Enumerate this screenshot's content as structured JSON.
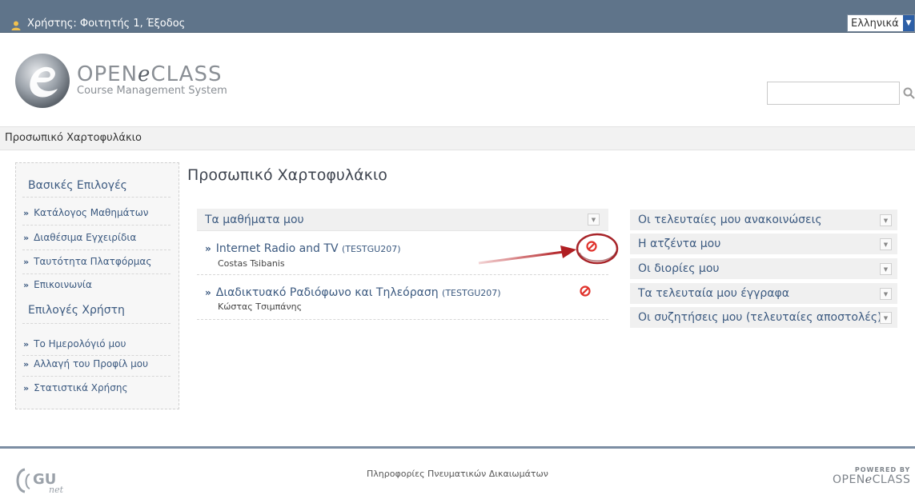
{
  "topbar": {
    "user_text": "Χρήστης: Φοιτητής 1, Έξοδος",
    "language": "Ελληνικά"
  },
  "logo": {
    "brand_open": "OPEN",
    "brand_e": "e",
    "brand_class": "CLASS",
    "subtitle": "Course Management System"
  },
  "search": {
    "placeholder": ""
  },
  "breadcrumb": {
    "current": "Προσωπικό Χαρτοφυλάκιο"
  },
  "sidebar": {
    "basic_heading": "Βασικές Επιλογές",
    "basic_items": [
      {
        "label": "Κατάλογος Μαθημάτων"
      },
      {
        "label": "Διαθέσιμα Εγχειρίδια"
      },
      {
        "label": "Ταυτότητα Πλατφόρμας"
      },
      {
        "label": "Επικοινωνία"
      }
    ],
    "user_heading": "Επιλογές Χρήστη",
    "user_items": [
      {
        "label": "Το Ημερολόγιό μου"
      },
      {
        "label": "Αλλαγή του Προφίλ μου"
      },
      {
        "label": "Στατιστικά Χρήσης"
      }
    ],
    "bullet": "»"
  },
  "main": {
    "title": "Προσωπικό Χαρτοφυλάκιο",
    "courses_header": "Τα μαθήματα μου",
    "courses": [
      {
        "name": "Internet Radio and TV",
        "code": "(TESTGU207)",
        "instructor": "Costas Tsibanis"
      },
      {
        "name": "Διαδικτυακό Ραδιόφωνο και Τηλεόραση",
        "code": "(TESTGU207)",
        "instructor": "Κώστας Τσιμπάνης"
      }
    ],
    "bullet": "»"
  },
  "right_panel": {
    "items": [
      {
        "label": "Οι τελευταίες μου ανακοινώσεις"
      },
      {
        "label": "Η ατζέντα μου"
      },
      {
        "label": "Οι διορίες μου"
      },
      {
        "label": "Τα τελευταία μου έγγραφα"
      },
      {
        "label": "Οι συζητήσεις μου (τελευταίες αποστολές)"
      }
    ]
  },
  "footer": {
    "copyright": "Πληροφορίες Πνευματικών Δικαιωμάτων",
    "powered_by": "POWERED BY",
    "brand_open": "OPEN",
    "brand_e": "e",
    "brand_class": "CLASS"
  },
  "colors": {
    "topbar": "#5f748a",
    "link": "#3c5a80",
    "annotation": "#c0282d"
  },
  "icons": [
    "user-icon",
    "chevron-down-icon",
    "search-icon",
    "toggle-down-icon",
    "unregister-icon"
  ]
}
